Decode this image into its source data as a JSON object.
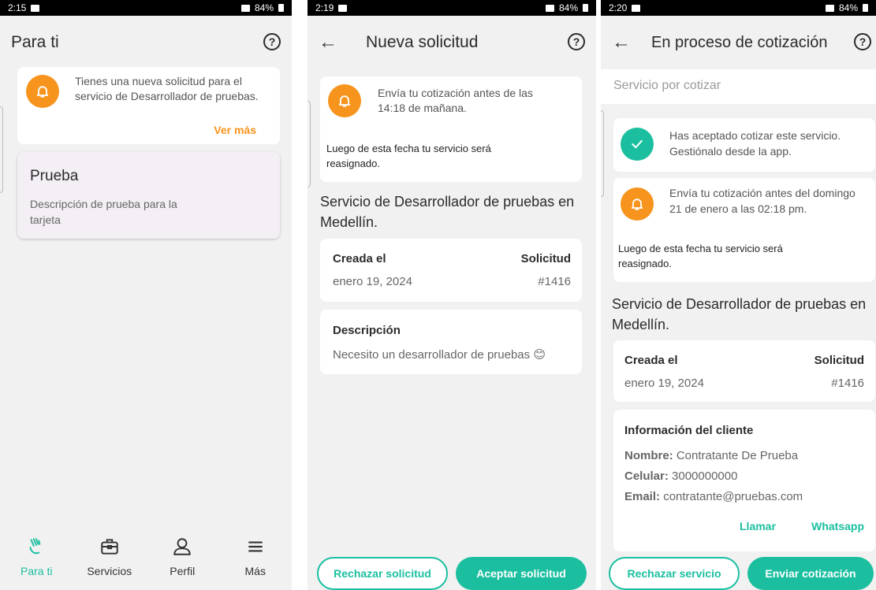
{
  "colors": {
    "accent": "#1bbfa0",
    "bell": "#f7941d",
    "background": "#f1f1f1"
  },
  "screen1": {
    "status": {
      "time": "2:15",
      "battery": "84%"
    },
    "title": "Para ti",
    "help_icon": "help-circle-icon",
    "notification": {
      "text": "Tienes una nueva solicitud para el servicio de Desarrollador de pruebas.",
      "link": "Ver más"
    },
    "card": {
      "title": "Prueba",
      "description": "Descripción de prueba para la tarjeta"
    },
    "nav": [
      {
        "label": "Para ti",
        "icon": "hand-wave-icon",
        "active": true
      },
      {
        "label": "Servicios",
        "icon": "briefcase-icon",
        "active": false
      },
      {
        "label": "Perfil",
        "icon": "user-icon",
        "active": false
      },
      {
        "label": "Más",
        "icon": "menu-icon",
        "active": false
      }
    ]
  },
  "screen2": {
    "status": {
      "time": "2:19",
      "battery": "84%"
    },
    "title": "Nueva solicitud",
    "deadline_text": "Envía tu cotización antes de las 14:18 de mañana.",
    "reassign_text": "Luego de esta fecha tu servicio será reasignado.",
    "service_heading": "Servicio de Desarrollador de pruebas en Medellín.",
    "created_label": "Creada el",
    "created_value": "enero 19, 2024",
    "request_label": "Solicitud",
    "request_value": "#1416",
    "description_label": "Descripción",
    "description_value": "Necesito un desarrollador de pruebas 😊",
    "reject_button": "Rechazar solicitud",
    "accept_button": "Aceptar solicitud"
  },
  "screen3": {
    "status": {
      "time": "2:20",
      "battery": "84%"
    },
    "title": "En proceso de cotización",
    "section_label": "Servicio por cotizar",
    "accepted_text": "Has aceptado cotizar este servicio. Gestiónalo desde la app.",
    "deadline_text": "Envía tu cotización antes del domingo 21 de enero a las 02:18 pm.",
    "reassign_text": "Luego de esta fecha tu servicio será reasignado.",
    "service_heading": "Servicio de Desarrollador de pruebas en Medellín.",
    "created_label": "Creada el",
    "created_value": "enero 19, 2024",
    "request_label": "Solicitud",
    "request_value": "#1416",
    "client": {
      "heading": "Información del cliente",
      "name_label": "Nombre:",
      "name_value": "Contratante De Prueba",
      "phone_label": "Celular:",
      "phone_value": "3000000000",
      "email_label": "Email:",
      "email_value": "contratante@pruebas.com",
      "call_link": "Llamar",
      "whatsapp_link": "Whatsapp"
    },
    "reject_button": "Rechazar servicio",
    "send_button": "Enviar cotización"
  }
}
